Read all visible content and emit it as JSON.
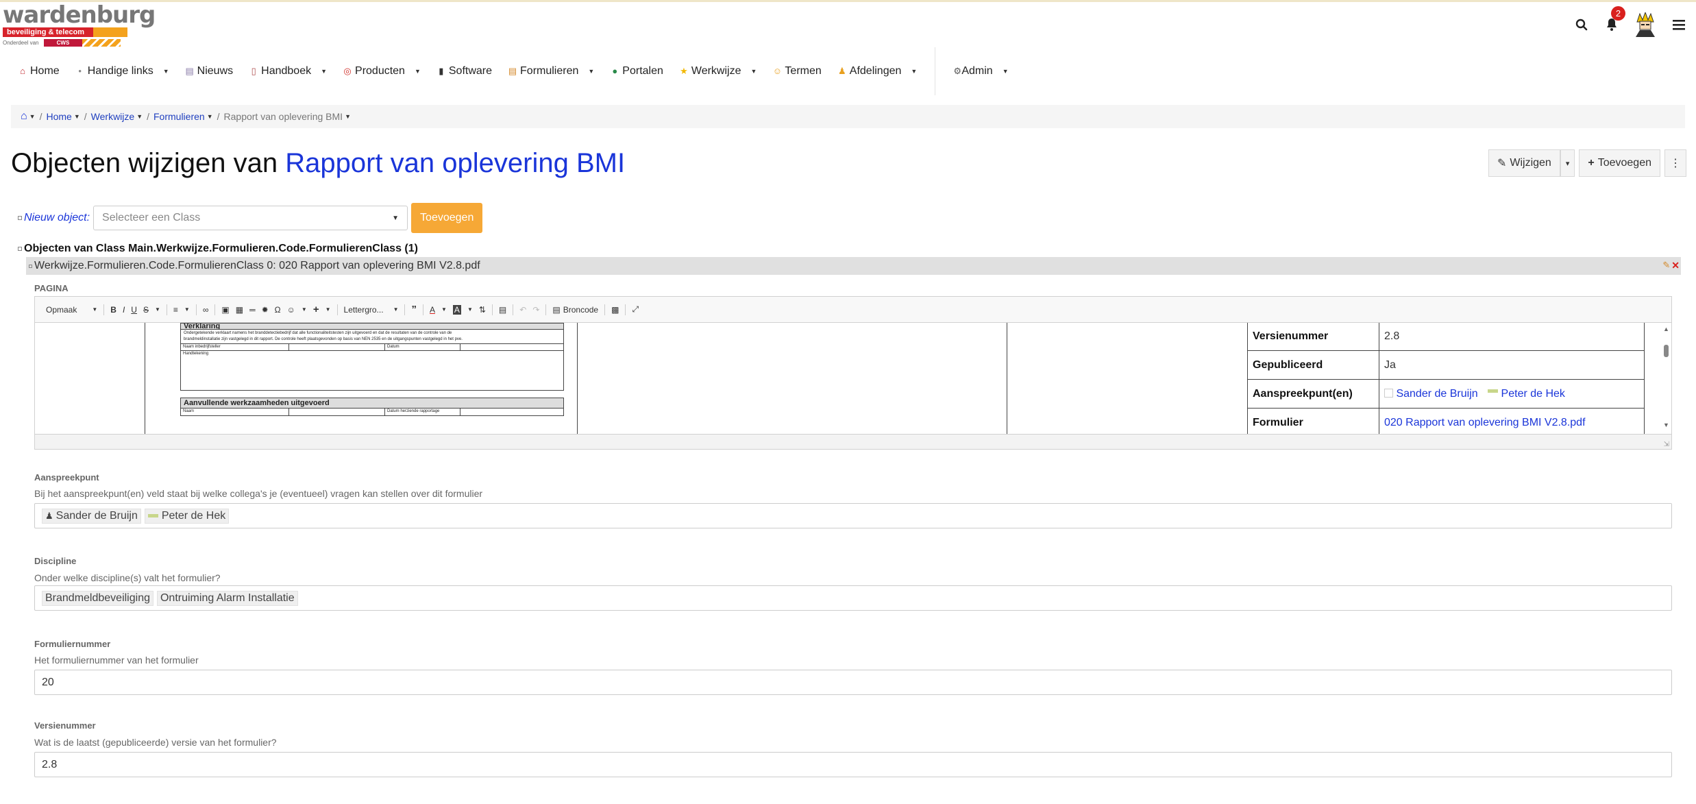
{
  "brand": {
    "name": "wardenburg",
    "tagline": "beveiliging & telecom",
    "sub_text": "Onderdeel van",
    "parent": "CWS"
  },
  "header": {
    "notification_count": "2"
  },
  "nav": {
    "items": [
      {
        "label": "Home",
        "icon": "home-icon",
        "dropdown": false
      },
      {
        "label": "Handige links",
        "icon": "link-icon",
        "dropdown": true
      },
      {
        "label": "Nieuws",
        "icon": "newspaper-icon",
        "dropdown": false
      },
      {
        "label": "Handboek",
        "icon": "book-icon",
        "dropdown": true
      },
      {
        "label": "Producten",
        "icon": "target-icon",
        "dropdown": true
      },
      {
        "label": "Software",
        "icon": "traffic-light-icon",
        "dropdown": false
      },
      {
        "label": "Formulieren",
        "icon": "scroll-icon",
        "dropdown": true
      },
      {
        "label": "Portalen",
        "icon": "globe-icon",
        "dropdown": false
      },
      {
        "label": "Werkwijze",
        "icon": "star-icon",
        "dropdown": true
      },
      {
        "label": "Termen",
        "icon": "face-icon",
        "dropdown": false
      },
      {
        "label": "Afdelingen",
        "icon": "person-icon",
        "dropdown": true
      }
    ],
    "admin": {
      "label": "Admin",
      "icon": "gear-icon"
    }
  },
  "breadcrumb": {
    "items": [
      "Home",
      "Werkwijze",
      "Formulieren"
    ],
    "current": "Rapport van oplevering BMI"
  },
  "page": {
    "title_prefix": "Objecten wijzigen van",
    "title_link": "Rapport van oplevering BMI",
    "edit_label": "Wijzigen",
    "add_label": "Toevoegen"
  },
  "new_object": {
    "label": "Nieuw object:",
    "select_placeholder": "Selecteer een Class",
    "add_button": "Toevoegen"
  },
  "objects": {
    "heading": "Objecten van Class Main.Werkwijze.Formulieren.Code.FormulierenClass (1)",
    "object_title": "Werkwijze.Formulieren.Code.FormulierenClass 0: 020 Rapport van oplevering BMI V2.8.pdf"
  },
  "editor": {
    "caption": "PAGINA",
    "toolbar": {
      "format": "Opmaak",
      "font": "Lettergro...",
      "source": "Broncode"
    },
    "pdf": {
      "section1_title": "Verklaring",
      "section1_text_1": "Ondergetekende verklaart namens het branddetectiebedrijf dat alle functionaliteitstesten zijn uitgevoerd en dat de resultaten van de controle van de",
      "section1_text_2": "brandmeldinstallatie zijn vastgelegd in dit rapport. De controle heeft plaatsgevonden op basis van NEN 2535 en de uitgangspunten vastgelegd in het pve.",
      "col_name": "Naam inbedrijfsteller",
      "col_date": "Datum",
      "col_sign": "Handtekening",
      "section2_title": "Aanvullende werkzaamheden uitgevoerd",
      "col_name2": "Naam",
      "col_date2": "Datum herziende rapportage"
    },
    "meta": [
      {
        "key": "Versienummer",
        "value": "2.8"
      },
      {
        "key": "Gepubliceerd",
        "value": "Ja"
      },
      {
        "key": "Aanspreekpunt(en)",
        "value_1": "Sander de Bruijn",
        "value_2": "Peter de Hek"
      },
      {
        "key": "Formulier",
        "value": "020 Rapport van oplevering BMI V2.8.pdf"
      }
    ]
  },
  "fields": {
    "aanspreekpunt": {
      "label": "Aanspreekpunt",
      "help": "Bij het aanspreekpunt(en) veld staat bij welke collega's je (eventueel) vragen kan stellen over dit formulier",
      "tags": [
        "Sander de Bruijn",
        "Peter de Hek"
      ]
    },
    "discipline": {
      "label": "Discipline",
      "help": "Onder welke discipline(s) valt het formulier?",
      "tags": [
        "Brandmeldbeveiliging",
        "Ontruiming Alarm Installatie"
      ]
    },
    "formuliernummer": {
      "label": "Formuliernummer",
      "help": "Het formuliernummer van het formulier",
      "value": "20"
    },
    "versienummer": {
      "label": "Versienummer",
      "help": "Wat is de laatst (gepubliceerde) versie van het formulier?",
      "value": "2.8"
    }
  },
  "colors": {
    "link": "#1a35d9",
    "accent_orange": "#f6a836",
    "badge_red": "#d9201d",
    "brand_red": "#d7232b"
  }
}
